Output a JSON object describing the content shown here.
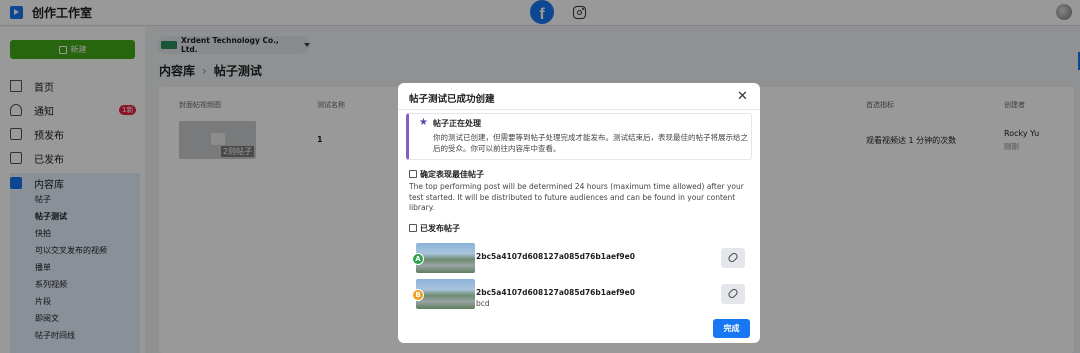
{
  "app": {
    "title": "创作工作室"
  },
  "topbar": {
    "facebook_glyph": "f",
    "icons": [
      "facebook-icon",
      "instagram-icon",
      "avatar"
    ]
  },
  "sidebar": {
    "create_label": "新建",
    "items": [
      {
        "label": "首页",
        "icon": "home-icon"
      },
      {
        "label": "通知",
        "icon": "bell-icon",
        "badge": "1新"
      },
      {
        "label": "预发布",
        "icon": "file-icon"
      },
      {
        "label": "已发布",
        "icon": "calendar-icon"
      }
    ],
    "library": {
      "label": "内容库",
      "sub_items": [
        "帖子",
        "帖子测试",
        "快拍",
        "可以交叉发布的视频",
        "播单",
        "系列视频",
        "片段",
        "即阅文",
        "帖子时间线"
      ]
    }
  },
  "main": {
    "account": "Xrdent Technology Co., Ltd.",
    "breadcrumb": {
      "parent": "内容库",
      "separator": "›",
      "current": "帖子测试"
    },
    "table": {
      "headers": [
        "封面帖视频图",
        "测试名称",
        "首选指标",
        "创建者"
      ],
      "row": {
        "thumb_count": "2则帖子",
        "test_name": "1",
        "metric": "观看视频达 1 分钟的次数",
        "creator": "Rocky Yu",
        "creator_sub": "刚刚"
      }
    }
  },
  "modal": {
    "title": "帖子测试已成功创建",
    "close": "✕",
    "info": {
      "heading": "帖子正在处理",
      "body": "你的测试已创建，但需要等到帖子处理完成才能发布。测试结束后，表现最佳的帖子将展示给之后的受众。你可以前往内容库中查看。"
    },
    "section_best": {
      "heading": "确定表现最佳帖子",
      "body": "The top performing post will be determined 24 hours (maximum time allowed) after your test started. It will be distributed to future audiences and can be found in your content library."
    },
    "section_published": {
      "heading": "已发布帖子"
    },
    "posts": [
      {
        "letter": "A",
        "id": "2bc5a4107d608127a085d76b1aef9e0",
        "sub": "",
        "color": "#31a24c"
      },
      {
        "letter": "B",
        "id": "2bc5a4107d608127a085d76b1aef9e0",
        "sub": "bcd",
        "color": "#f0a01e"
      }
    ],
    "done_label": "完成"
  }
}
